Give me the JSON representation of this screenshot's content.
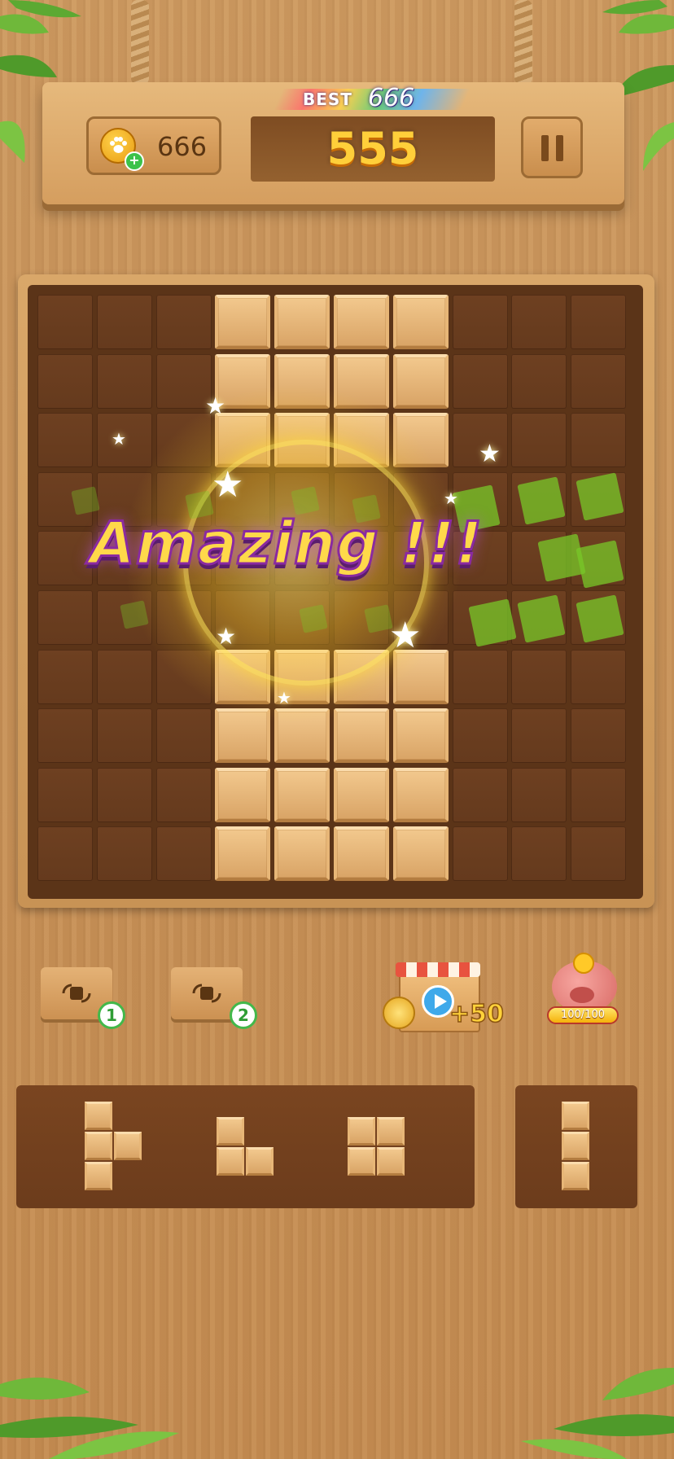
{
  "header": {
    "coin_count": "666",
    "best_label": "BEST",
    "best_value": "666",
    "score": "555"
  },
  "board": {
    "rows": 10,
    "cols": 10,
    "wood_cells": [
      [
        0,
        3
      ],
      [
        0,
        4
      ],
      [
        0,
        5
      ],
      [
        0,
        6
      ],
      [
        1,
        3
      ],
      [
        1,
        4
      ],
      [
        1,
        5
      ],
      [
        1,
        6
      ],
      [
        2,
        3
      ],
      [
        2,
        4
      ],
      [
        2,
        5
      ],
      [
        2,
        6
      ],
      [
        6,
        3
      ],
      [
        6,
        4
      ],
      [
        6,
        5
      ],
      [
        6,
        6
      ],
      [
        7,
        3
      ],
      [
        7,
        4
      ],
      [
        7,
        5
      ],
      [
        7,
        6
      ],
      [
        8,
        3
      ],
      [
        8,
        4
      ],
      [
        8,
        5
      ],
      [
        8,
        6
      ],
      [
        9,
        3
      ],
      [
        9,
        4
      ],
      [
        9,
        5
      ],
      [
        9,
        6
      ]
    ]
  },
  "banner": {
    "text": "Amazing !!!"
  },
  "boosters": {
    "swap1_badge": "1",
    "swap2_badge": "2",
    "shop_reward": "+50",
    "piggy_progress_text": "100/100",
    "piggy_progress_fraction": 1.0
  },
  "pieces": [
    {
      "name": "t-piece",
      "cells": [
        [
          0,
          0
        ],
        [
          1,
          0
        ],
        [
          1,
          1
        ],
        [
          2,
          0
        ]
      ]
    },
    {
      "name": "l-piece",
      "cells": [
        [
          0,
          0
        ],
        [
          1,
          0
        ],
        [
          1,
          1
        ]
      ]
    },
    {
      "name": "square-piece",
      "cells": [
        [
          0,
          0
        ],
        [
          0,
          1
        ],
        [
          1,
          0
        ],
        [
          1,
          1
        ]
      ]
    },
    {
      "name": "vertical-line-piece",
      "cells": [
        [
          0,
          0
        ],
        [
          1,
          0
        ],
        [
          2,
          0
        ]
      ]
    }
  ],
  "colors": {
    "wood_light": "#f2c88d",
    "cell_dark": "#6e4021",
    "score_gold": "#ffcf3a",
    "banner_purple": "#8a2aa0",
    "clear_green": "#78c828"
  }
}
